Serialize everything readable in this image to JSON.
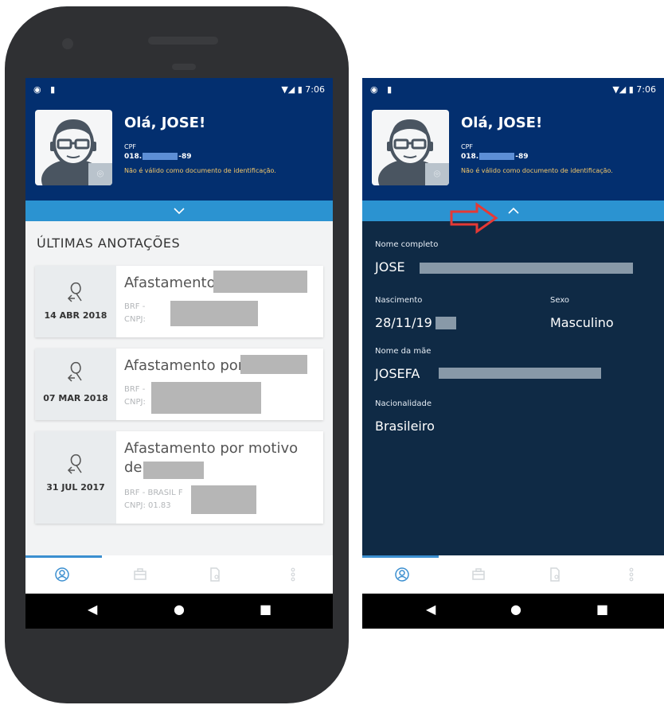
{
  "status_bar": {
    "left_icons": "◉ ▮",
    "time": "7:06",
    "right_icons": "▼◢ ▮"
  },
  "profile": {
    "greeting": "Olá, JOSE!",
    "cpf_label": "CPF",
    "cpf_prefix": "018.",
    "cpf_suffix": "-89",
    "doc_note": "Não é válido como documento de identificação."
  },
  "screen1": {
    "section_title": "ÚLTIMAS ANOTAÇÕES",
    "cards": [
      {
        "date": "14 ABR 2018",
        "title": "Afastamento",
        "line1": "BRF -",
        "line2": "CNPJ: "
      },
      {
        "date": "07 MAR 2018",
        "title": "Afastamento por",
        "line1": "BRF -",
        "line2": "CNPJ:"
      },
      {
        "date": "31 JUL 2017",
        "title": "Afastamento por motivo de",
        "line1": "BRF - BRASIL F",
        "line2": "CNPJ: 01.83"
      }
    ]
  },
  "screen2": {
    "fields": {
      "nome_label": "Nome completo",
      "nome_value": "JOSE",
      "nascimento_label": "Nascimento",
      "nascimento_value": "28/11/19",
      "sexo_label": "Sexo",
      "sexo_value": "Masculino",
      "mae_label": "Nome da mãe",
      "mae_value": "JOSEFA",
      "nacionalidade_label": "Nacionalidade",
      "nacionalidade_value": "Brasileiro"
    }
  },
  "bottom_nav": {
    "tabs": [
      "profile-icon",
      "briefcase-icon",
      "document-icon",
      "more-icon"
    ]
  },
  "system_nav": {
    "back": "◀",
    "home": "●",
    "recents": "■"
  },
  "colors": {
    "header": "#032f6f",
    "toggle_bar": "#2b93d1",
    "details_bg": "#0f2a45",
    "highlight_arrow": "#e53935"
  }
}
